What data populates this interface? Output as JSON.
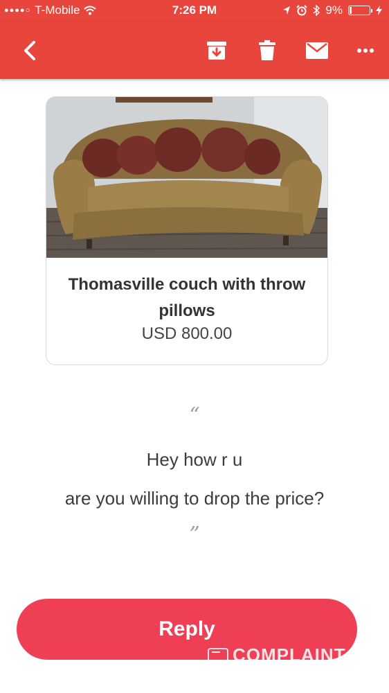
{
  "status_bar": {
    "carrier": "T-Mobile",
    "time": "7:26 PM",
    "battery": "9%",
    "battery_level": 0.09,
    "icons": [
      "signal-dots-icon",
      "wifi-icon",
      "location-arrow-icon",
      "alarm-icon",
      "bluetooth-icon",
      "battery-icon",
      "charging-bolt-icon"
    ]
  },
  "toolbar": {
    "color": "#e8453c",
    "icons": [
      "back-chevron-icon",
      "archive-icon",
      "trash-icon",
      "mail-icon",
      "more-dots-icon"
    ]
  },
  "listing": {
    "title": "Thomasville couch with throw pillows",
    "price": "USD 800.00",
    "image": "couch-photo"
  },
  "message": {
    "open_quote": "“",
    "line1": "Hey how r u",
    "line2": "are you willing to drop the price?",
    "close_quote": "”"
  },
  "reply": {
    "label": "Reply",
    "color": "#ee3f55"
  },
  "watermark": {
    "text": "COMPLAINT"
  }
}
